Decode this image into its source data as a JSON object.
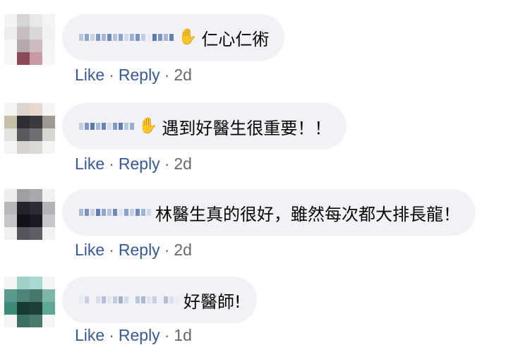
{
  "comments": [
    {
      "text": "仁心仁術",
      "has_wave": true,
      "actions": {
        "like": "Like",
        "reply": "Reply",
        "time": "2d"
      },
      "avatar_colors": [
        "#f3f3f3",
        "#d5d5d5",
        "#e9e9e9",
        "#f4f4f4",
        "#eeeeee",
        "#c9bfc1",
        "#dcd6d8",
        "#f1f1f1",
        "#f6f6f6",
        "#b6a9ad",
        "#cdbbc0",
        "#f4f4f4",
        "#f7f7f7",
        "#8b4a5a",
        "#c89aa6",
        "#f6f6f6"
      ],
      "name_colors": [
        "#b9c6dc",
        "#8ea4c8",
        "#c9d3e4",
        "#7f96bf",
        "#a7b6d2",
        "#6e88b7",
        "#b3c1da",
        "#8aa0c7",
        "#d2daea",
        "#9cb0d0",
        "#7a92bd",
        "#c0cce1",
        "#e8ecf4",
        "#5f7cb0",
        "#7d95be",
        "#a4b5d3",
        "#6881b3"
      ]
    },
    {
      "text": "遇到好醫生很重要！！",
      "has_wave": true,
      "actions": {
        "like": "Like",
        "reply": "Reply",
        "time": "2d"
      },
      "avatar_colors": [
        "#f4f4f4",
        "#dcd4cf",
        "#e8d8cf",
        "#f5f5f5",
        "#c7c0a8",
        "#2f2e33",
        "#3a3a40",
        "#9e9a92",
        "#e3e2dc",
        "#5a5a5e",
        "#6e6d70",
        "#d8d6d0",
        "#f5f5f5",
        "#d6d4cc",
        "#dcdad4",
        "#f5f5f5"
      ],
      "name_colors": [
        "#c2cde2",
        "#7d94be",
        "#5b78ad",
        "#a6b6d2",
        "#6a84b4",
        "#d9e0ed",
        "#8198c1",
        "#5f7bb0",
        "#b8c5dc",
        "#9aaed0"
      ]
    },
    {
      "text": "林醫生真的很好，雖然每次都大排長龍！",
      "has_wave": false,
      "actions": {
        "like": "Like",
        "reply": "Reply",
        "time": "2d"
      },
      "avatar_colors": [
        "#eeeeee",
        "#9fa0a4",
        "#a9a9ad",
        "#f1f1f1",
        "#b9b8bd",
        "#23232b",
        "#2d2c36",
        "#b5b3b8",
        "#c7c5c9",
        "#121219",
        "#1b1a22",
        "#c9c7cb",
        "#f0f0f0",
        "#57555c",
        "#605e64",
        "#f2f2f2"
      ],
      "name_colors": [
        "#a9b9d6",
        "#7c93bd",
        "#c8d2e4",
        "#5f7bb0",
        "#93a7cb",
        "#b7c4dc",
        "#7088b8",
        "#dde3ef",
        "#8aa0c6",
        "#c3cee3",
        "#6f88b7",
        "#a0b2d1",
        "#d0d9ea"
      ]
    },
    {
      "text": "好醫師!",
      "has_wave": false,
      "actions": {
        "like": "Like",
        "reply": "Reply",
        "time": "1d"
      },
      "avatar_colors": [
        "#f5f5f5",
        "#9fd3c9",
        "#a8d9d0",
        "#f4f4f4",
        "#5a9a8c",
        "#4f8578",
        "#46776c",
        "#7db7aa",
        "#3d8a78",
        "#173b32",
        "#1c3f37",
        "#5ea797",
        "#f5f5f5",
        "#3e6f63",
        "#4a7a6e",
        "#f5f5f5"
      ],
      "name_colors": [
        "#e6eaf2",
        "#c9d2e4",
        "#f1f3f8",
        "#d7deeb",
        "#b3c0d9",
        "#e2e7f0",
        "#c0cbe0",
        "#9fb0d0",
        "#d4dbe9",
        "#eef1f7",
        "#b9c5dc",
        "#a8b7d4",
        "#dfe5ef",
        "#c5cfe2",
        "#edf0f6",
        "#b0bed8",
        "#d9e0ec",
        "#e9edf4"
      ]
    }
  ]
}
